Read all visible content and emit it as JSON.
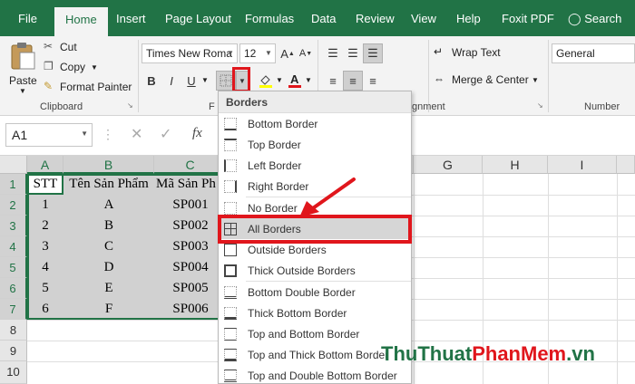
{
  "ribbon_tabs": [
    "File",
    "Home",
    "Insert",
    "Page Layout",
    "Formulas",
    "Data",
    "Review",
    "View",
    "Help",
    "Foxit PDF",
    "Search"
  ],
  "clipboard": {
    "paste": "Paste",
    "cut": "Cut",
    "copy": "Copy",
    "format_painter": "Format Painter",
    "group": "Clipboard"
  },
  "font": {
    "name": "Times New Roma",
    "size": "12",
    "group": "F"
  },
  "alignment": {
    "wrap_text": "Wrap Text",
    "merge_center": "Merge & Center",
    "group": "gnment"
  },
  "number": {
    "format": "General",
    "group": "Number"
  },
  "formula_bar": {
    "name_box": "A1",
    "fx": "fx"
  },
  "columns": [
    "A",
    "B",
    "C",
    "G",
    "H",
    "I"
  ],
  "rows": [
    "1",
    "2",
    "3",
    "4",
    "5",
    "6",
    "7",
    "8",
    "9",
    "10"
  ],
  "sheet": {
    "header": [
      "STT",
      "Tên Sản Phẩm",
      "Mã Sản Ph"
    ],
    "rows": [
      [
        "1",
        "A",
        "SP001"
      ],
      [
        "2",
        "B",
        "SP002"
      ],
      [
        "3",
        "C",
        "SP003"
      ],
      [
        "4",
        "D",
        "SP004"
      ],
      [
        "5",
        "E",
        "SP005"
      ],
      [
        "6",
        "F",
        "SP006"
      ]
    ]
  },
  "borders_menu": {
    "title": "Borders",
    "items": [
      "Bottom Border",
      "Top Border",
      "Left Border",
      "Right Border",
      "No Border",
      "All Borders",
      "Outside Borders",
      "Thick Outside Borders",
      "Bottom Double Border",
      "Thick Bottom Border",
      "Top and Bottom Border",
      "Top and Thick Bottom Border",
      "Top and Double Bottom Border"
    ]
  },
  "watermark": {
    "part1": "ThuThuat",
    "part2": "PhanMem",
    "part3": ".vn"
  },
  "colors": {
    "excel_green": "#217346",
    "highlight_red": "#e0161c",
    "selection_gray": "#d1d1d1"
  }
}
